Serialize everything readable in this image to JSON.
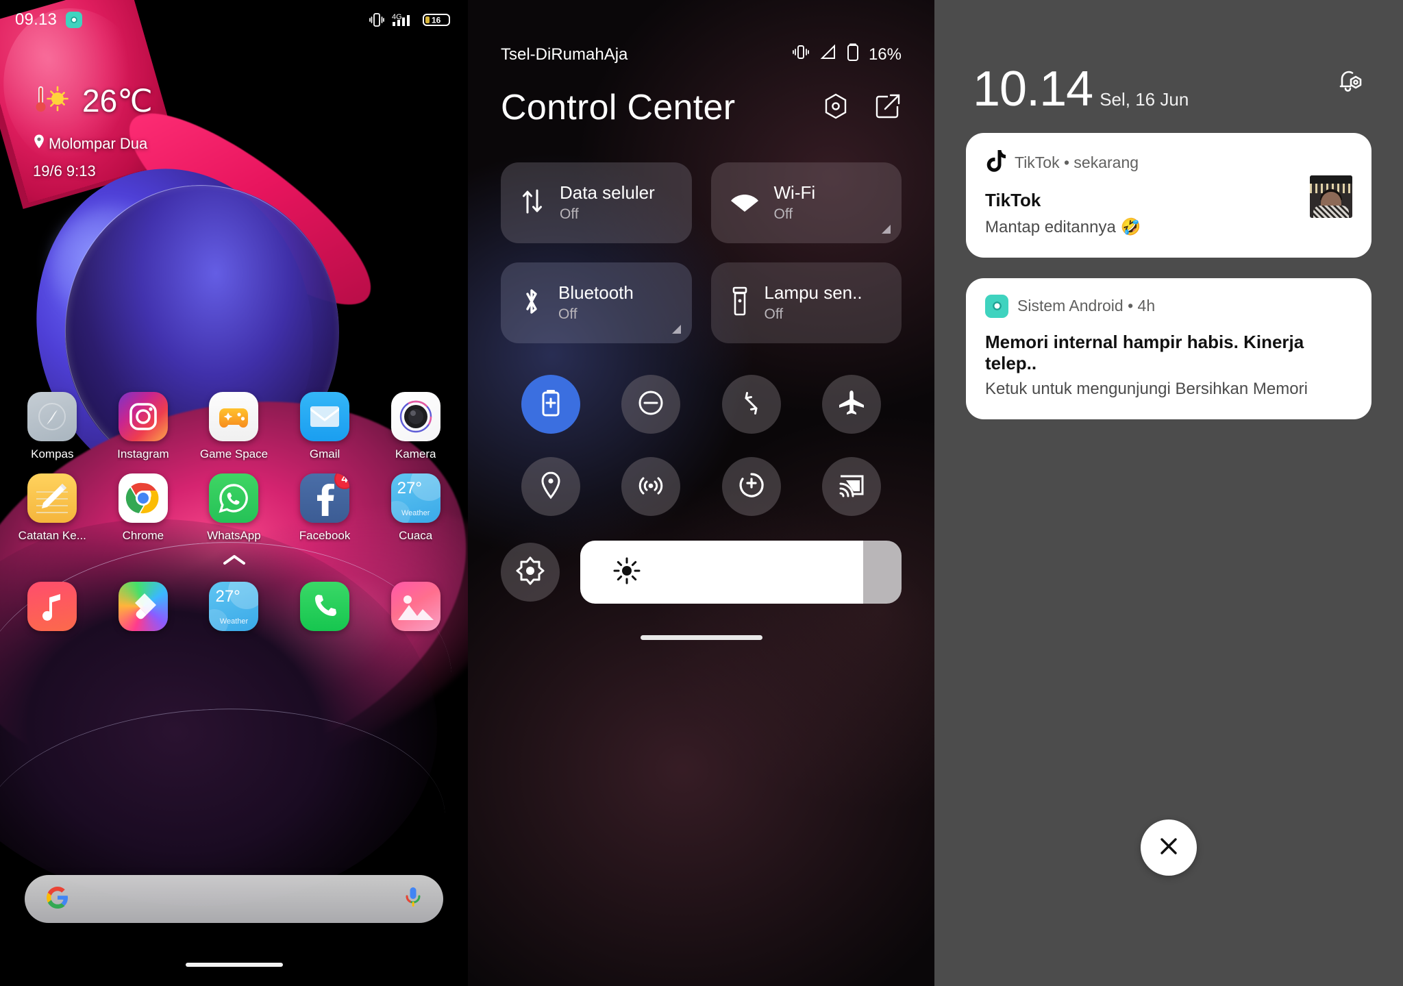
{
  "home": {
    "status_bar": {
      "time": "09.13",
      "battery_level": "16",
      "network": "4G",
      "vibrate_icon": "vibrate-icon",
      "signal_icon": "signal-bars-icon",
      "battery_icon": "battery-icon",
      "app_icon": "cleaner-app-icon"
    },
    "weather": {
      "temperature": "26℃",
      "location": "Molompar Dua",
      "datetime": "19/6 9:13",
      "icon": "sun-thermometer-icon",
      "pin_icon": "location-pin-icon"
    },
    "apps_row1": [
      {
        "label": "Kompas",
        "icon": "compass-icon"
      },
      {
        "label": "Instagram",
        "icon": "instagram-icon"
      },
      {
        "label": "Game Space",
        "icon": "gamepad-icon"
      },
      {
        "label": "Gmail",
        "icon": "mail-icon"
      },
      {
        "label": "Kamera",
        "icon": "camera-icon"
      }
    ],
    "apps_row2": [
      {
        "label": "Catatan Ke...",
        "icon": "notes-icon",
        "badge": ""
      },
      {
        "label": "Chrome",
        "icon": "chrome-icon",
        "badge": ""
      },
      {
        "label": "WhatsApp",
        "icon": "whatsapp-icon",
        "badge": ""
      },
      {
        "label": "Facebook",
        "icon": "facebook-icon",
        "badge": "4"
      },
      {
        "label": "Cuaca",
        "icon": "weather-widget-icon",
        "badge": "",
        "temp": "27°",
        "sub": "Weather"
      }
    ],
    "dock": [
      {
        "label": "Music",
        "icon": "music-note-icon"
      },
      {
        "label": "Themes",
        "icon": "theme-brush-icon"
      },
      {
        "label": "Weather",
        "icon": "weather-icon",
        "temp": "27°",
        "sub": "Weather"
      },
      {
        "label": "Phone",
        "icon": "phone-icon"
      },
      {
        "label": "Gallery",
        "icon": "gallery-icon"
      }
    ],
    "page_chevron_icon": "chevron-up-icon",
    "search": {
      "google_icon": "google-g-icon",
      "mic_icon": "microphone-icon",
      "placeholder": ""
    }
  },
  "control_center": {
    "status_bar": {
      "carrier": "Tsel-DiRumahAja",
      "battery_percent": "16%",
      "vibrate_icon": "vibrate-icon",
      "signal_icon": "signal-triangle-icon",
      "battery_icon": "battery-icon"
    },
    "title": "Control Center",
    "header_icons": [
      {
        "name": "settings-hex-icon"
      },
      {
        "name": "edit-pencil-icon"
      }
    ],
    "tiles": [
      {
        "label": "Data seluler",
        "state": "Off",
        "icon": "data-arrows-icon",
        "expandable": false
      },
      {
        "label": "Wi-Fi",
        "state": "Off",
        "icon": "wifi-icon",
        "expandable": true
      },
      {
        "label": "Bluetooth",
        "state": "Off",
        "icon": "bluetooth-icon",
        "expandable": true
      },
      {
        "label": "Lampu sen..",
        "state": "Off",
        "icon": "flashlight-icon",
        "expandable": false
      }
    ],
    "toggles": [
      {
        "name": "battery-saver-toggle",
        "icon": "battery-plus-icon",
        "active": true
      },
      {
        "name": "do-not-disturb-toggle",
        "icon": "minus-circle-icon",
        "active": false
      },
      {
        "name": "auto-rotate-toggle",
        "icon": "rotate-icon",
        "active": false
      },
      {
        "name": "airplane-mode-toggle",
        "icon": "airplane-icon",
        "active": false
      },
      {
        "name": "location-toggle",
        "icon": "location-pin-icon",
        "active": false
      },
      {
        "name": "hotspot-toggle",
        "icon": "hotspot-icon",
        "active": false
      },
      {
        "name": "screen-recorder-toggle",
        "icon": "record-plus-icon",
        "active": false
      },
      {
        "name": "cast-toggle",
        "icon": "cast-icon",
        "active": false
      }
    ],
    "brightness": {
      "button_icon": "brightness-auto-icon",
      "slider_icon": "sun-icon",
      "value_percent": 88
    },
    "active_accent": "#3b6fe0"
  },
  "notifications": {
    "clock": "10.14",
    "date": "Sel, 16 Jun",
    "settings_icon": "notification-settings-icon",
    "items": [
      {
        "app": "TikTok • sekarang",
        "app_icon": "tiktok-icon",
        "title": "TikTok",
        "body": "Mantap editannya 🤣",
        "has_thumb": true
      },
      {
        "app": "Sistem Android • 4h",
        "app_icon": "android-system-icon",
        "title": "Memori internal hampir habis. Kinerja telep..",
        "body": "Ketuk untuk mengunjungi Bersihkan Memori",
        "has_thumb": false
      }
    ],
    "close_button": {
      "icon": "close-x-icon",
      "label": "×"
    },
    "background": "#4c4c4c"
  }
}
